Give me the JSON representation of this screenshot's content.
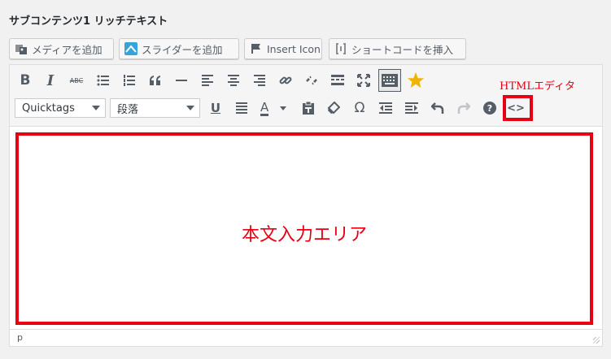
{
  "section": {
    "title": "サブコンテンツ1 リッチテキスト"
  },
  "media_buttons": [
    {
      "label": "メディアを追加",
      "icon": "media-icon"
    },
    {
      "label": "スライダーを追加",
      "icon": "slider-icon"
    },
    {
      "label": "Insert Icon",
      "icon": "flag-icon"
    },
    {
      "label": "ショートコードを挿入",
      "icon": "shortcode-icon"
    }
  ],
  "toolbar": {
    "row1": [
      "bold",
      "italic",
      "strikethrough",
      "bullet-list",
      "numbered-list",
      "blockquote",
      "horizontal-rule",
      "align-left",
      "align-center",
      "align-right",
      "link",
      "unlink",
      "read-more",
      "fullscreen",
      "toolbar-toggle",
      "star"
    ],
    "row2": [
      "underline",
      "justify",
      "text-color",
      "paste-as-text",
      "clear-formatting",
      "special-character",
      "outdent",
      "indent",
      "undo",
      "redo",
      "help",
      "code"
    ],
    "quicktags_select": "Quicktags",
    "format_select": "段落",
    "bold_label": "B",
    "italic_label": "I",
    "strike_label": "ABC",
    "underline_label": "U",
    "textcolor_label": "A",
    "omega_label": "Ω",
    "code_label": "<>",
    "help_label": "?"
  },
  "status_bar": {
    "path": "p"
  },
  "annotations": {
    "body_area_label": "本文入力エリア",
    "html_editor_label": "HTMLエディタ",
    "color": "#e60012"
  }
}
